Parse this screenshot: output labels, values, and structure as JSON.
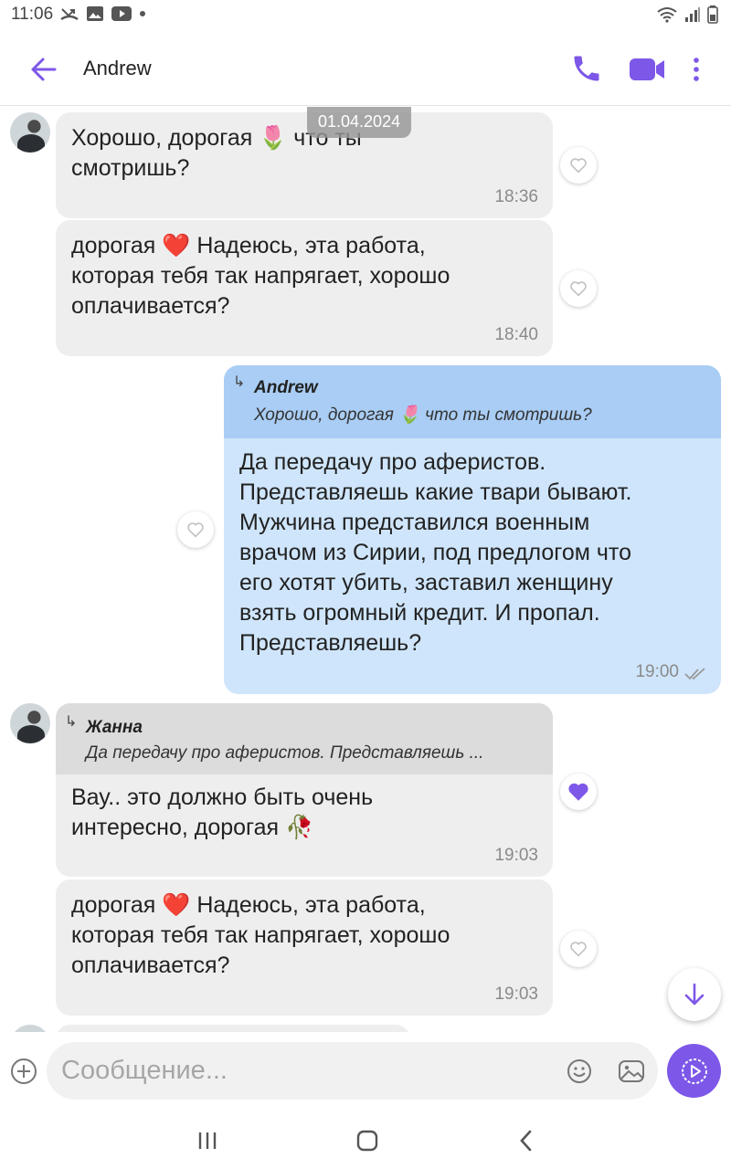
{
  "status_bar": {
    "time": "11:06"
  },
  "header": {
    "contact_name": "Andrew"
  },
  "chat": {
    "date_divider": "01.04.2024",
    "messages": [
      {
        "text": "Хорошо, дорогая 🌷 что ты\nсмотришь?",
        "time": "18:36"
      },
      {
        "text": "дорогая ❤️ Надеюсь, эта работа,\nкоторая тебя так напрягает, хорошо\nоплачивается?",
        "time": "18:40"
      },
      {
        "quote_author": "Andrew",
        "quote_text": "Хорошо, дорогая 🌷 что ты смотришь?",
        "text": "Да передачу про аферистов.\nПредставляешь какие твари бывают.\nМужчина представился военным\nврачом из Сирии, под предлогом что\nего хотят убить, заставил женщину\nвзять огромный кредит. И пропал.\nПредставляешь?",
        "time": "19:00"
      },
      {
        "quote_author": "Жанна",
        "quote_text": "Да передачу про аферистов.  Представляешь ...",
        "text": "Вау.. это должно быть очень\nинтересно, дорогая 🥀",
        "time": "19:03"
      },
      {
        "text": "дорогая ❤️ Надеюсь, эта работа,\nкоторая тебя так напрягает, хорошо\nоплачивается?",
        "time": "19:03"
      }
    ]
  },
  "composer": {
    "placeholder": "Сообщение..."
  },
  "colors": {
    "accent": "#7d57e8",
    "incoming_bubble": "#eeeeee",
    "outgoing_bubble": "#cfe5fb",
    "quote_out": "#a9cdf4"
  },
  "icons": [
    "back-arrow-icon",
    "phone-icon",
    "video-camera-icon",
    "more-vert-icon",
    "heart-outline-icon",
    "heart-filled-icon",
    "arrow-down-icon",
    "plus-circle-icon",
    "emoji-icon",
    "gallery-icon",
    "send-icon",
    "double-check-icon"
  ]
}
